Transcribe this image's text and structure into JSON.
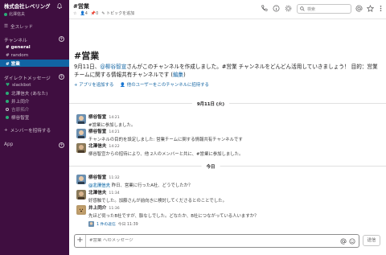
{
  "workspace": {
    "name": "株式会社レベリング",
    "user": "北澤信夫"
  },
  "sidebar": {
    "threads": "全スレッド",
    "channels_header": "チャンネル",
    "channels": [
      {
        "label": "# general"
      },
      {
        "label": "# random"
      },
      {
        "label": "# 営業"
      }
    ],
    "dm_header": "ダイレクトメッセージ",
    "dms": [
      {
        "label": "slackbot"
      },
      {
        "label": "北澤信夫 (あなた)"
      },
      {
        "label": "井上同介"
      },
      {
        "label": "吉原拓介"
      },
      {
        "label": "柳谷智宣"
      }
    ],
    "invite": "メンバーを招待する",
    "apps_header": "App"
  },
  "header": {
    "channel": "#営業",
    "members": "4",
    "pins": "0",
    "add_topic": "トピックを追加",
    "search_placeholder": "検索"
  },
  "intro": {
    "title": "#営業",
    "text_1": "9月11日、",
    "mention": "@柳谷智宣",
    "text_2": "さんがこのチャンネルを作成しました。#営業 チャンネルをどんどん活用していきましょう！ 目的：営業チームに関する情報共有チャンネルです (",
    "edit": "編集",
    "text_3": ")",
    "add_app": "+ アプリを追加する",
    "invite_others": "他のユーザーをこのチャンネルに招待する"
  },
  "day_dividers": [
    "9月11日 (火)",
    "今日"
  ],
  "messages": [
    {
      "name": "柳谷智宣",
      "time": "14:21",
      "text": "#営業に参加しました。"
    },
    {
      "name": "柳谷智宣",
      "time": "14:21",
      "text": "チャンネルの目的を設定しました: 営業チームに関する情報共有チャンネルです"
    },
    {
      "name": "北澤信夫",
      "time": "14:22",
      "text": "柳谷智宣からの招待により、他 2人のメンバーと共に、#営業に参加しました。"
    },
    {
      "name": "柳谷智宣",
      "time": "11:32",
      "mention": "@北澤信夫",
      "text": "昨日、営業に行ったA社、どうでしたか？"
    },
    {
      "name": "北澤信夫",
      "time": "11:34",
      "text": "好感触でした。加藤さんが前向きに検討してくださるとのことでした。"
    },
    {
      "name": "井上同介",
      "time": "11:36",
      "text": "先ほど伺ったB社ですが、脈なしでした。どなたか、B社につながっている人いますか？",
      "thread_replies": "1 件の返信",
      "thread_time": "今日 11:39"
    }
  ],
  "composer": {
    "placeholder": "#営業 へのメッセージ",
    "send": "送信"
  },
  "colors": {
    "sidebar": "#3f0e40",
    "active": "#1164a3",
    "online": "#2bac76",
    "link": "#1264a3"
  }
}
